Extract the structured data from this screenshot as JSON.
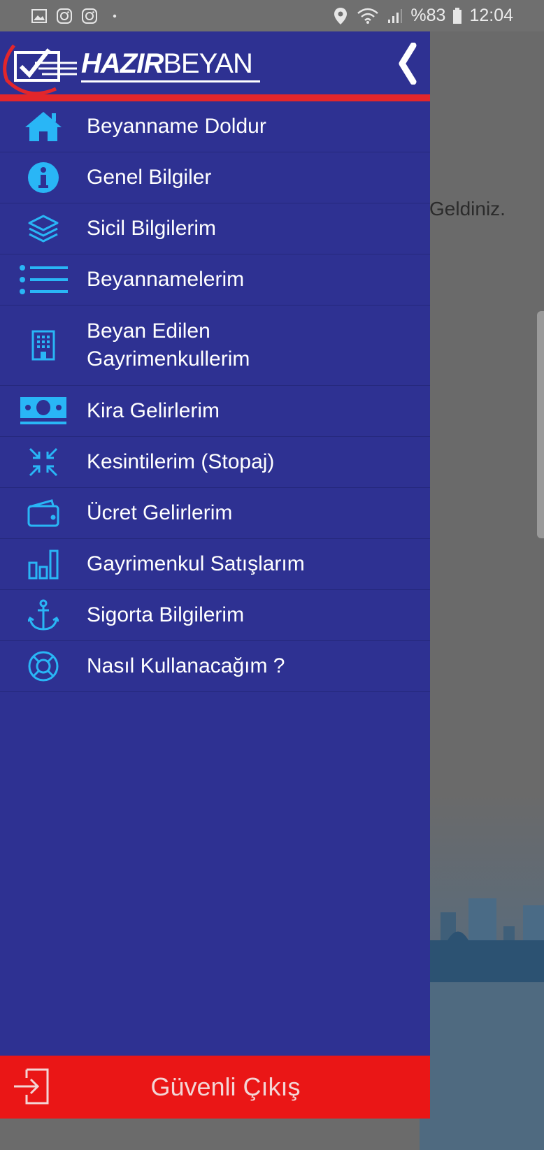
{
  "status_bar": {
    "battery": "%83",
    "time": "12:04"
  },
  "background": {
    "welcome_text": "Geldiniz."
  },
  "header": {
    "logo_bold": "HAZIR",
    "logo_light": "BEYAN"
  },
  "menu": {
    "items": [
      {
        "label": "Beyanname Doldur",
        "icon": "home-icon"
      },
      {
        "label": "Genel Bilgiler",
        "icon": "info-icon"
      },
      {
        "label": "Sicil Bilgilerim",
        "icon": "layers-icon"
      },
      {
        "label": "Beyannamelerim",
        "icon": "list-icon"
      },
      {
        "label": "Beyan Edilen Gayrimenkullerim",
        "icon": "building-icon"
      },
      {
        "label": "Kira Gelirlerim",
        "icon": "money-icon"
      },
      {
        "label": "Kesintilerim (Stopaj)",
        "icon": "compress-icon"
      },
      {
        "label": "Ücret Gelirlerim",
        "icon": "wallet-icon"
      },
      {
        "label": "Gayrimenkul Satışlarım",
        "icon": "bar-chart-icon"
      },
      {
        "label": "Sigorta Bilgilerim",
        "icon": "anchor-icon"
      },
      {
        "label": "Nasıl Kullanacağım ?",
        "icon": "lifebuoy-icon"
      }
    ]
  },
  "footer": {
    "logout_label": "Güvenli Çıkış"
  },
  "colors": {
    "drawer_bg": "#2e3192",
    "accent_red": "#e3262b",
    "icon_blue": "#29b6f6",
    "logout_bg": "#ea1616"
  }
}
